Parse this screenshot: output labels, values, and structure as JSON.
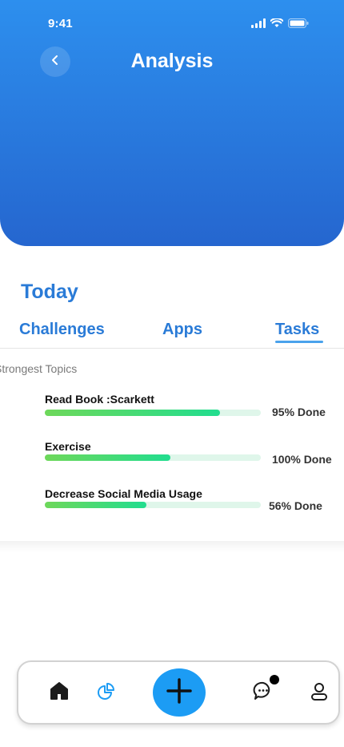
{
  "status_bar": {
    "time": "9:41"
  },
  "header": {
    "title": "Analysis"
  },
  "section": {
    "title": "Today"
  },
  "tabs": [
    {
      "label": "Challenges",
      "active": false
    },
    {
      "label": "Apps",
      "active": false
    },
    {
      "label": "Tasks",
      "active": true
    }
  ],
  "card": {
    "heading": "Strongest Topics",
    "items": [
      {
        "label": "Read Book :Scarkett",
        "progress": 0.81,
        "status": "95% Done"
      },
      {
        "label": "Exercise",
        "progress": 0.58,
        "status": "100% Done"
      },
      {
        "label": "Decrease Social Media Usage",
        "progress": 0.47,
        "status": "56% Done"
      }
    ]
  },
  "nav": {
    "items": [
      "home-icon",
      "analytics-icon",
      "add-icon",
      "chat-icon",
      "profile-icon"
    ],
    "chat_has_badge": true
  },
  "colors": {
    "header_gradient_top": "#2d8fee",
    "header_gradient_bottom": "#2566cf",
    "accent": "#2a7bd7",
    "progress_start": "#6ed85a",
    "progress_end": "#21dd8f",
    "fab": "#1c9cf4"
  }
}
